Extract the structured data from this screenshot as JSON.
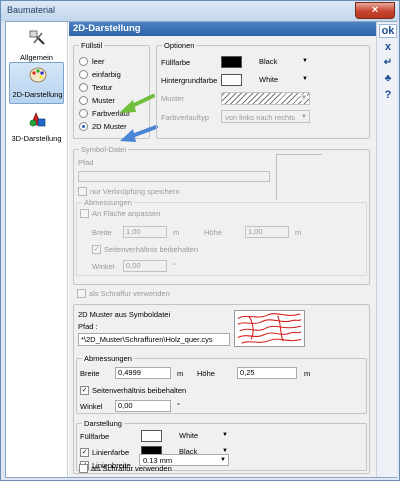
{
  "window": {
    "title": "Baumaterial",
    "close_label": "×"
  },
  "nav": {
    "items": [
      {
        "label": "Allgemein"
      },
      {
        "label": "2D-Darstellung"
      },
      {
        "label": "3D-Darstellung"
      }
    ]
  },
  "header": {
    "title": "2D-Darstellung"
  },
  "toolbar": {
    "ok_label": "ok",
    "cancel_label": "x",
    "apply_label": "↵",
    "ext_label": "♣",
    "help_label": "?"
  },
  "fuellstil": {
    "title": "Füllstil",
    "options": [
      "leer",
      "einfarbig",
      "Textur",
      "Muster",
      "Farbverlauf",
      "2D Muster"
    ],
    "selected": "2D Muster"
  },
  "optionen": {
    "title": "Optionen",
    "fuellfarbe_label": "Füllfarbe",
    "fuellfarbe_value": "Black",
    "hintergrund_label": "Hintergrundfarbe",
    "hintergrund_value": "White",
    "muster_label": "Muster",
    "verlauf_label": "Farbverlauftyp",
    "verlauf_value": "von links nach rechts"
  },
  "symbol_disabled": {
    "title": "Symbol-Datei",
    "pfad_label": "Pfad",
    "nur_verknuepfung": "nur Verknüpfung speichern",
    "abmessungen_title": "Abmessungen",
    "an_flaeche": "An Fläche anpassen",
    "breite_label": "Breite",
    "breite_value": "1,00",
    "hoehe_label": "Höhe",
    "hoehe_value": "1,00",
    "unit_m": "m",
    "seiten": "Seitenverhältnis beibehalten",
    "winkel_label": "Winkel",
    "winkel_value": "0,00",
    "unit_deg": "°",
    "schraffur": "als Schraffur verwenden"
  },
  "muster2d": {
    "title": "2D Muster aus Symboldatei",
    "pfad_label": "Pfad :",
    "pfad_value": "*\\2D_Muster\\Schraffuren\\Holz_quer.cys",
    "abmessungen_title": "Abmessungen",
    "breite_label": "Breite",
    "breite_value": "0,4999",
    "hoehe_label": "Höhe",
    "hoehe_value": "0,25",
    "unit_m": "m",
    "seiten": "Seitenverhältnis beibehalten",
    "winkel_label": "Winkel",
    "winkel_value": "0,00",
    "unit_deg": "°",
    "darstellung_title": "Darstellung",
    "fuellfarbe_label": "Füllfarbe",
    "fuellfarbe_value": "White",
    "linienfarbe_label": "Linienfarbe",
    "linienfarbe_value": "Black",
    "linienbreite_label": "Linienbreite",
    "linienbreite_value": "0.13 mm",
    "schraffur": "als Schraffur verwenden"
  },
  "colors": {
    "accent": "#2e64a8",
    "arrow_green": "#6fbf3a",
    "arrow_blue": "#4b86d6",
    "pattern": "#d21c1c"
  }
}
